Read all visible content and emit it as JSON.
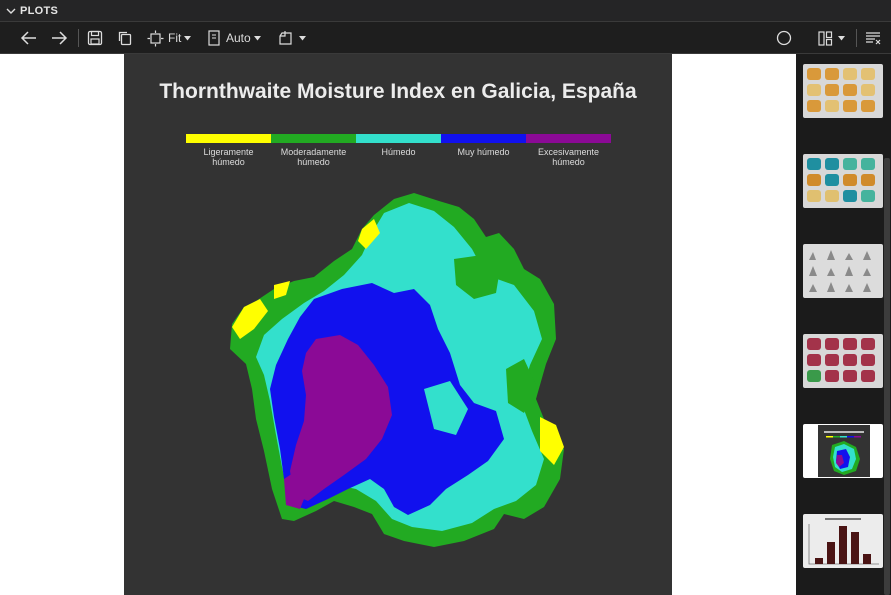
{
  "panel": {
    "title": "PLOTS"
  },
  "toolbar": {
    "fit_label": "Fit",
    "auto_label": "Auto",
    "icons": [
      "back-arrow-icon",
      "forward-arrow-icon",
      "save-icon",
      "copy-icon",
      "zoom-fit-icon",
      "page-size-icon",
      "export-icon",
      "circle-icon",
      "layout-icon",
      "clear-list-icon"
    ]
  },
  "plot": {
    "title": "Thornthwaite Moisture Index en Galicia, España",
    "legend": [
      {
        "label": "Ligeramente\nhúmedo",
        "color": "#ffff00"
      },
      {
        "label": "Moderadamente\nhúmedo",
        "color": "#22aa22"
      },
      {
        "label": "Húmedo",
        "color": "#33e0cc"
      },
      {
        "label": "Muy húmedo",
        "color": "#1111ee"
      },
      {
        "label": "Excesivamente\nhúmedo",
        "color": "#8b0a96"
      }
    ]
  },
  "thumbnails": [
    {
      "name": "thumb-orange-maps",
      "selected": false
    },
    {
      "name": "thumb-teal-maps",
      "selected": false
    },
    {
      "name": "thumb-histograms",
      "selected": false
    },
    {
      "name": "thumb-red-maps",
      "selected": false
    },
    {
      "name": "thumb-moisture-map",
      "selected": true
    },
    {
      "name": "thumb-bar-chart",
      "selected": false
    }
  ]
}
